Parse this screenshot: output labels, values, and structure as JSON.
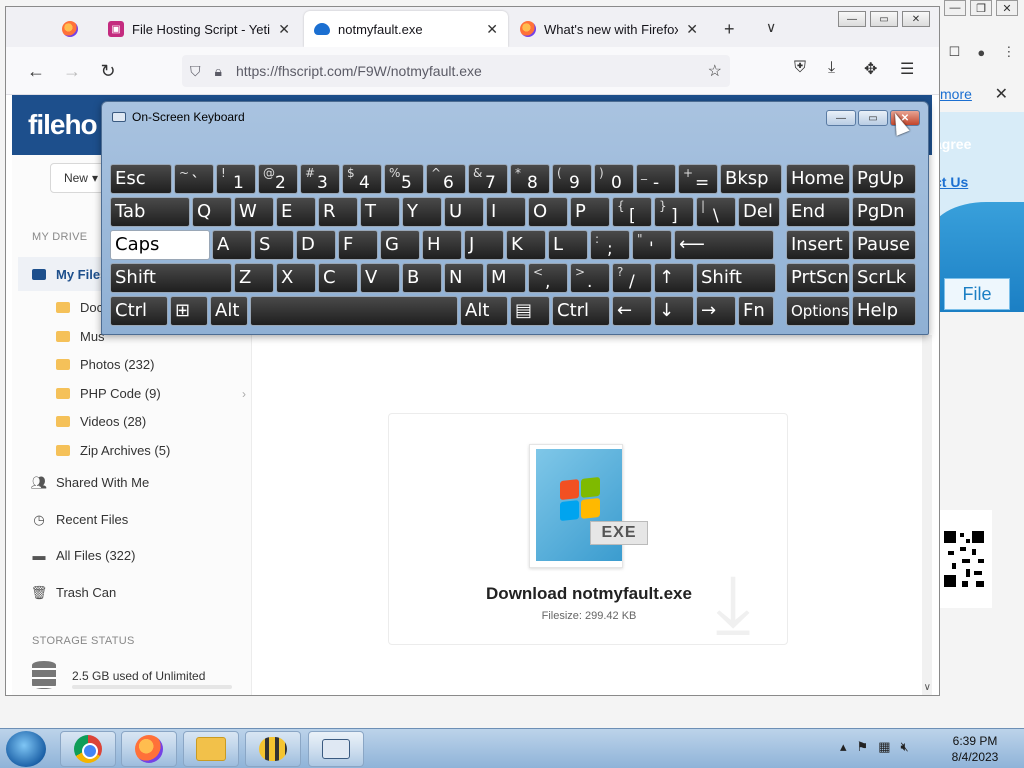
{
  "browser": {
    "tabs": [
      {
        "label": "",
        "icon": "firefox-icon"
      },
      {
        "label": "File Hosting Script - Yetisha",
        "icon": "hosting-icon"
      },
      {
        "label": "notmyfault.exe",
        "icon": "cloud-icon",
        "active": true
      },
      {
        "label": "What's new with Firefox - M",
        "icon": "firefox-icon"
      }
    ],
    "url": "https://fhscript.com/F9W/notmyfault.exe"
  },
  "site": {
    "logo_main": "fileho",
    "new_button": "New"
  },
  "sidebar": {
    "my_drive_label": "MY DRIVE",
    "my_files": "My Files",
    "folders": [
      {
        "label": "Docu"
      },
      {
        "label": "Mus"
      },
      {
        "label": "Photos (232)"
      },
      {
        "label": "PHP Code (9)"
      },
      {
        "label": "Videos (28)"
      },
      {
        "label": "Zip Archives (5)"
      }
    ],
    "shared": "Shared With Me",
    "recent": "Recent Files",
    "all_files": "All Files (322)",
    "trash": "Trash Can",
    "storage_label": "STORAGE STATUS",
    "storage_text": "2.5 GB used of Unlimited"
  },
  "file": {
    "exe_tag": "EXE",
    "download_title": "Download notmyfault.exe",
    "filesize": "Filesize: 299.42 KB"
  },
  "background": {
    "learn_more": "more",
    "agree": "agree",
    "contact": "ct Us",
    "file_btn": "File"
  },
  "osk": {
    "title": "On-Screen Keyboard",
    "rows": [
      [
        "Esc",
        "~ `",
        "! 1",
        "@ 2",
        "# 3",
        "$ 4",
        "% 5",
        "^ 6",
        "& 7",
        "* 8",
        "( 9",
        ") 0",
        "_ -",
        "+ =",
        "Bksp",
        "Home",
        "PgUp"
      ],
      [
        "Tab",
        "Q",
        "W",
        "E",
        "R",
        "T",
        "Y",
        "U",
        "I",
        "O",
        "P",
        "{ [",
        "} ]",
        "| \\",
        "Del",
        "End",
        "PgDn"
      ],
      [
        "Caps",
        "A",
        "S",
        "D",
        "F",
        "G",
        "H",
        "J",
        "K",
        "L",
        ": ;",
        "\" '",
        "⟵",
        "Insert",
        "Pause"
      ],
      [
        "Shift",
        "Z",
        "X",
        "C",
        "V",
        "B",
        "N",
        "M",
        "< ,",
        "> .",
        "? /",
        "↑",
        "Shift",
        "PrtScn",
        "ScrLk"
      ],
      [
        "Ctrl",
        "⊞",
        "Alt",
        "",
        "Alt",
        "▤",
        "Ctrl",
        "←",
        "↓",
        "→",
        "Fn",
        "Options",
        "Help"
      ]
    ]
  },
  "taskbar": {
    "time": "6:39 PM",
    "date": "8/4/2023"
  }
}
